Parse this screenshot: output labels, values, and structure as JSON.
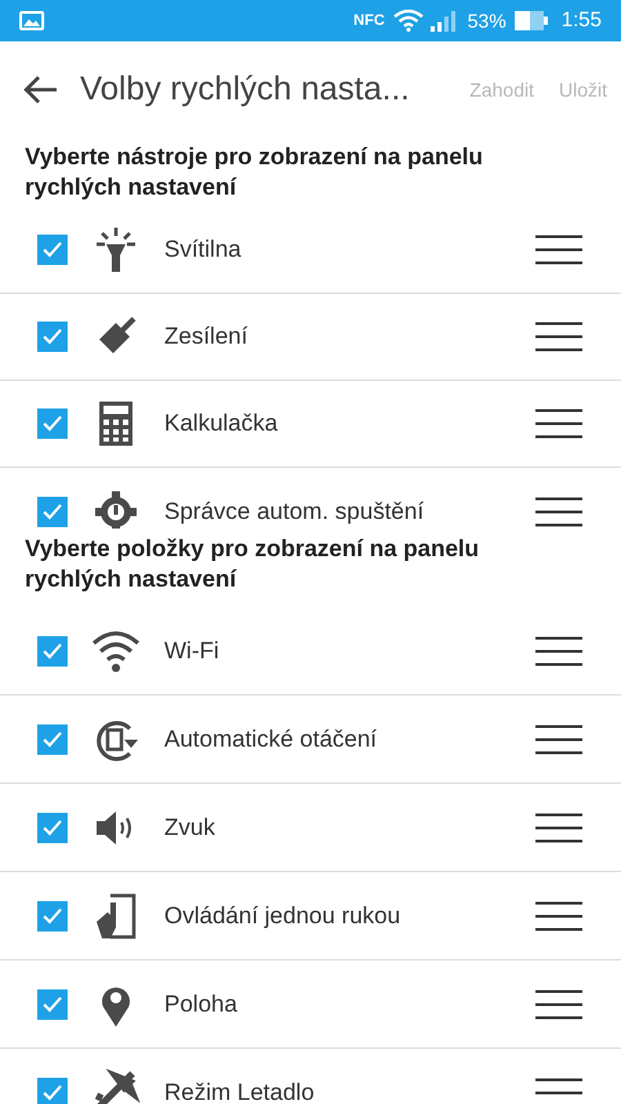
{
  "status_bar": {
    "nfc": "NFC",
    "battery": "53%",
    "time": "1:55"
  },
  "toolbar": {
    "title": "Volby rychlých nasta...",
    "actions": [
      {
        "label": "Zahodit",
        "disabled": true
      },
      {
        "label": "Uložit",
        "disabled": true
      }
    ]
  },
  "sections": [
    {
      "heading": "Vyberte nástroje pro zobrazení na panelu rychlých nastavení",
      "items": [
        {
          "label": "Svítilna",
          "checked": true
        },
        {
          "label": "Zesílení",
          "checked": true
        },
        {
          "label": "Kalkulačka",
          "checked": true
        },
        {
          "label": "Správce autom. spuštění",
          "checked": true
        }
      ]
    },
    {
      "heading": "Vyberte položky pro zobrazení na panelu rychlých nastavení",
      "items": [
        {
          "label": "Wi-Fi",
          "checked": true
        },
        {
          "label": "Automatické otáčení",
          "checked": true
        },
        {
          "label": "Zvuk",
          "checked": true
        },
        {
          "label": "Ovládání jednou rukou",
          "checked": true
        },
        {
          "label": "Poloha",
          "checked": true
        },
        {
          "label": "Režim Letadlo",
          "checked": true
        }
      ]
    }
  ]
}
